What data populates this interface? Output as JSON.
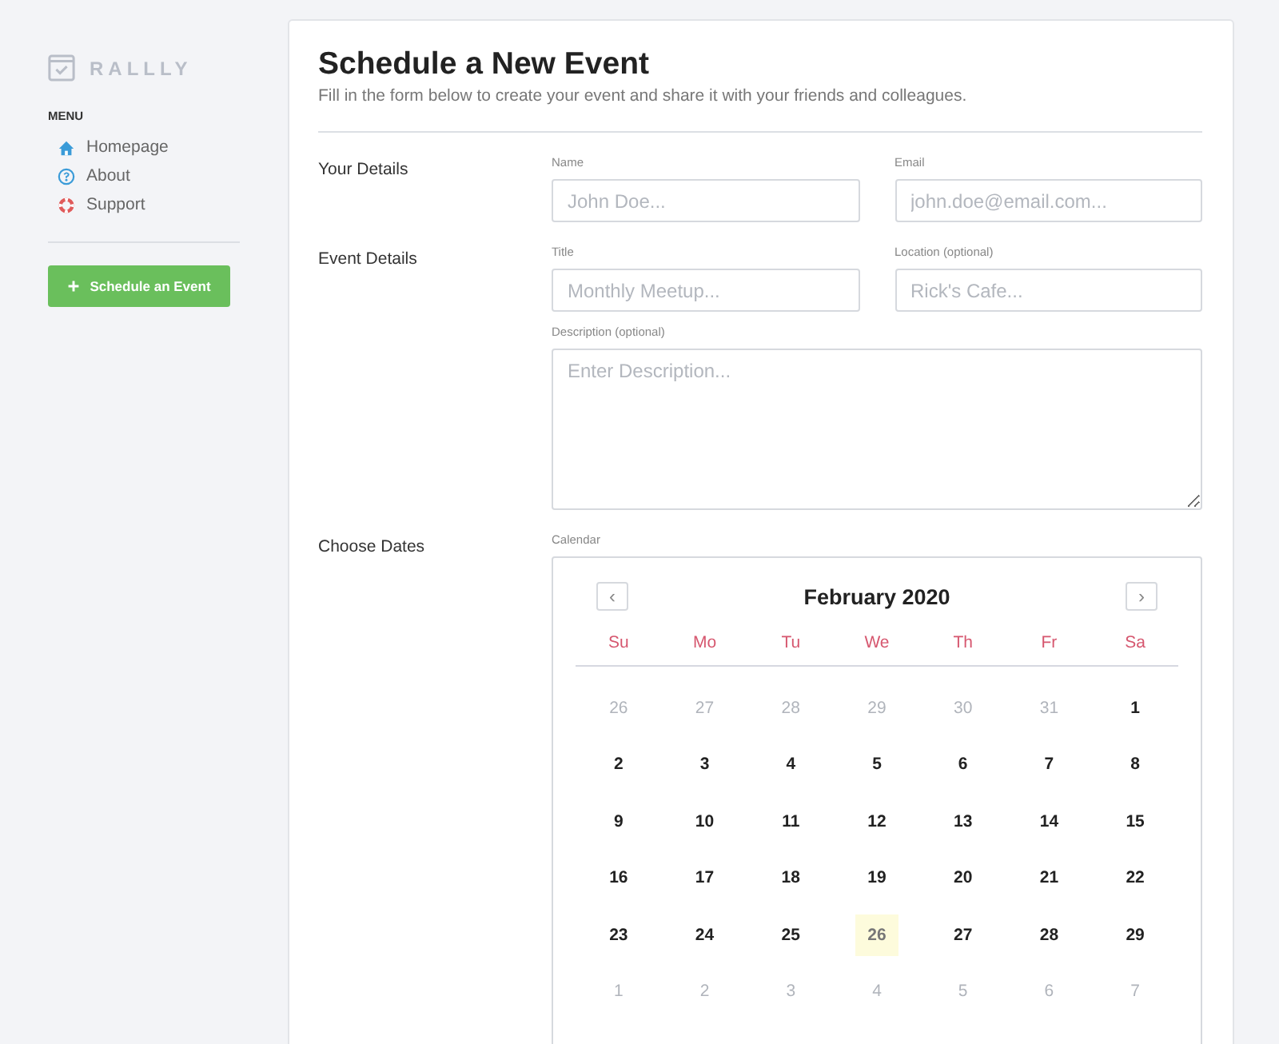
{
  "sidebar": {
    "logo": "RALLLY",
    "menu_heading": "MENU",
    "items": [
      {
        "label": "Homepage",
        "kind": "home"
      },
      {
        "label": "About",
        "kind": "about"
      },
      {
        "label": "Support",
        "kind": "support"
      }
    ],
    "button": "Schedule an Event"
  },
  "form": {
    "title": "Schedule a New Event",
    "subtitle": "Fill in the form below to create your event and share it with your friends and colleagues.",
    "your_details": {
      "label": "Your Details",
      "name": {
        "label": "Name",
        "placeholder": "John Doe..."
      },
      "email": {
        "label": "Email",
        "placeholder": "john.doe@email.com..."
      }
    },
    "event_details": {
      "label": "Event Details",
      "title": {
        "label": "Title",
        "placeholder": "Monthly Meetup..."
      },
      "location": {
        "label": "Location (optional)",
        "placeholder": "Rick's Cafe..."
      },
      "description": {
        "label": "Description (optional)",
        "placeholder": "Enter Description..."
      }
    },
    "dates": {
      "label": "Choose Dates",
      "calendar_label": "Calendar",
      "month": "February 2020",
      "prev": "‹",
      "next": "›",
      "weekdays": [
        "Su",
        "Mo",
        "Tu",
        "We",
        "Th",
        "Fr",
        "Sa"
      ],
      "weeks": [
        [
          {
            "day": "26",
            "outside": true,
            "today": false
          },
          {
            "day": "27",
            "outside": true,
            "today": false
          },
          {
            "day": "28",
            "outside": true,
            "today": false
          },
          {
            "day": "29",
            "outside": true,
            "today": false
          },
          {
            "day": "30",
            "outside": true,
            "today": false
          },
          {
            "day": "31",
            "outside": true,
            "today": false
          },
          {
            "day": "1",
            "outside": false,
            "today": false
          }
        ],
        [
          {
            "day": "2",
            "outside": false,
            "today": false
          },
          {
            "day": "3",
            "outside": false,
            "today": false
          },
          {
            "day": "4",
            "outside": false,
            "today": false
          },
          {
            "day": "5",
            "outside": false,
            "today": false
          },
          {
            "day": "6",
            "outside": false,
            "today": false
          },
          {
            "day": "7",
            "outside": false,
            "today": false
          },
          {
            "day": "8",
            "outside": false,
            "today": false
          }
        ],
        [
          {
            "day": "9",
            "outside": false,
            "today": false
          },
          {
            "day": "10",
            "outside": false,
            "today": false
          },
          {
            "day": "11",
            "outside": false,
            "today": false
          },
          {
            "day": "12",
            "outside": false,
            "today": false
          },
          {
            "day": "13",
            "outside": false,
            "today": false
          },
          {
            "day": "14",
            "outside": false,
            "today": false
          },
          {
            "day": "15",
            "outside": false,
            "today": false
          }
        ],
        [
          {
            "day": "16",
            "outside": false,
            "today": false
          },
          {
            "day": "17",
            "outside": false,
            "today": false
          },
          {
            "day": "18",
            "outside": false,
            "today": false
          },
          {
            "day": "19",
            "outside": false,
            "today": false
          },
          {
            "day": "20",
            "outside": false,
            "today": false
          },
          {
            "day": "21",
            "outside": false,
            "today": false
          },
          {
            "day": "22",
            "outside": false,
            "today": false
          }
        ],
        [
          {
            "day": "23",
            "outside": false,
            "today": false
          },
          {
            "day": "24",
            "outside": false,
            "today": false
          },
          {
            "day": "25",
            "outside": false,
            "today": false
          },
          {
            "day": "26",
            "outside": false,
            "today": true
          },
          {
            "day": "27",
            "outside": false,
            "today": false
          },
          {
            "day": "28",
            "outside": false,
            "today": false
          },
          {
            "day": "29",
            "outside": false,
            "today": false
          }
        ],
        [
          {
            "day": "1",
            "outside": true,
            "today": false
          },
          {
            "day": "2",
            "outside": true,
            "today": false
          },
          {
            "day": "3",
            "outside": true,
            "today": false
          },
          {
            "day": "4",
            "outside": true,
            "today": false
          },
          {
            "day": "5",
            "outside": true,
            "today": false
          },
          {
            "day": "6",
            "outside": true,
            "today": false
          },
          {
            "day": "7",
            "outside": true,
            "today": false
          }
        ]
      ]
    }
  }
}
